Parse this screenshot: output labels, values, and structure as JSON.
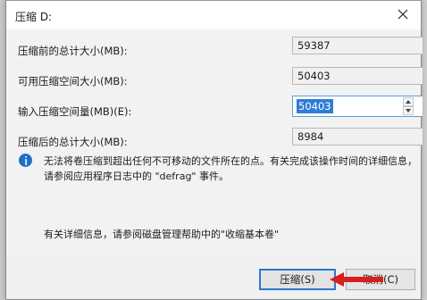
{
  "dialog": {
    "title": "压缩 D:",
    "rows": [
      {
        "label": "压缩前的总计大小(MB):",
        "value": "59387"
      },
      {
        "label": "可用压缩空间大小(MB):",
        "value": "50403"
      },
      {
        "label": "输入压缩空间量(MB)(E):",
        "value": "50403"
      },
      {
        "label": "压缩后的总计大小(MB):",
        "value": "8984"
      }
    ],
    "info_text": "无法将卷压缩到超出任何不可移动的文件所在的点。有关完成该操作时间的详细信息，请参阅应用程序日志中的 \"defrag\" 事件。",
    "more_info": "有关详细信息，请参阅磁盘管理帮助中的\"收缩基本卷\"",
    "buttons": {
      "primary": "压缩(S)",
      "cancel": "取消(C)"
    }
  },
  "colors": {
    "selection": "#2f7cd8",
    "info_icon": "#1f6fc5",
    "arrow": "#d81e1e"
  },
  "icons": {
    "close": "close-icon",
    "info": "info-icon",
    "spin_up": "chevron-up-icon",
    "spin_down": "chevron-down-icon",
    "pointer": "red-arrow-icon"
  }
}
